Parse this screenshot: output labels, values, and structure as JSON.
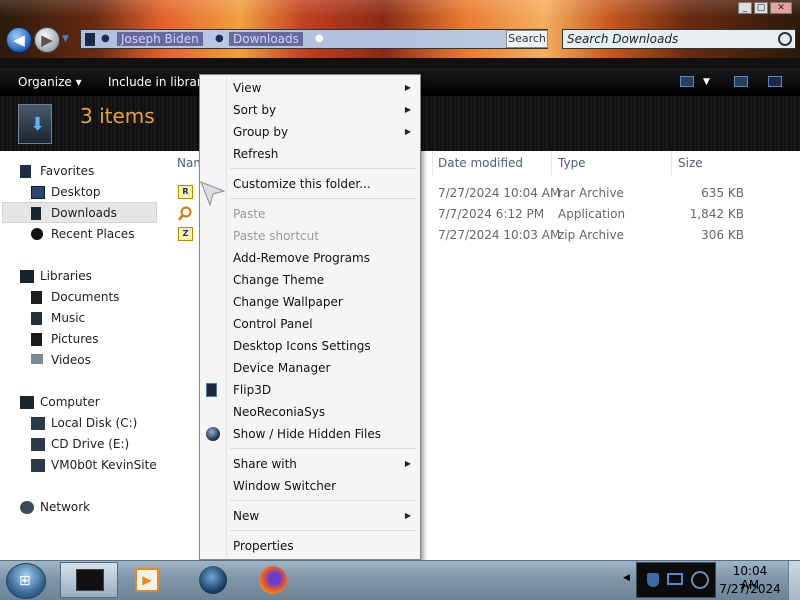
{
  "window": {
    "minimize_label": "_",
    "maximize_label": "▢",
    "close_label": "✕"
  },
  "address": {
    "crumbs": [
      "Joseph Biden",
      "Downloads"
    ],
    "search_button_label": "Search",
    "search_placeholder": "Search Downloads"
  },
  "toolbar": {
    "organize_label": "Organize ▾",
    "include_label": "Include in library"
  },
  "header": {
    "item_count": "3 items"
  },
  "nav": {
    "favorites": {
      "label": "Favorites",
      "items": [
        "Desktop",
        "Downloads",
        "Recent Places"
      ]
    },
    "libraries": {
      "label": "Libraries",
      "items": [
        "Documents",
        "Music",
        "Pictures",
        "Videos"
      ]
    },
    "computer": {
      "label": "Computer",
      "items": [
        "Local Disk (C:)",
        "CD Drive (E:)",
        "VM0b0t KevinSite"
      ]
    },
    "network": {
      "label": "Network"
    }
  },
  "columns": {
    "name": "Nam",
    "date_modified": "Date modified",
    "type": "Type",
    "size": "Size"
  },
  "files": [
    {
      "date": "7/27/2024 10:04 AM",
      "type": "rar Archive",
      "size": "635 KB",
      "icon": "rar-icon",
      "icon_glyph": "R"
    },
    {
      "date": "7/7/2024 6:12 PM",
      "type": "Application",
      "size": "1,842 KB",
      "icon": "application-icon",
      "icon_glyph": ""
    },
    {
      "date": "7/27/2024 10:03 AM",
      "type": "zip Archive",
      "size": "306 KB",
      "icon": "zip-icon",
      "icon_glyph": "Z"
    }
  ],
  "context_menu": {
    "view": "View",
    "sort_by": "Sort by",
    "group_by": "Group by",
    "refresh": "Refresh",
    "customize": "Customize this folder...",
    "paste": "Paste",
    "paste_shortcut": "Paste shortcut",
    "add_remove": "Add-Remove Programs",
    "change_theme": "Change Theme",
    "change_wallpaper": "Change Wallpaper",
    "control_panel": "Control Panel",
    "desktop_icons": "Desktop Icons Settings",
    "device_manager": "Device Manager",
    "flip3d": "Flip3D",
    "neoreconia": "NeoReconiaSys",
    "show_hide": "Show / Hide Hidden Files",
    "share_with": "Share with",
    "window_switcher": "Window Switcher",
    "new": "New",
    "properties": "Properties"
  },
  "taskbar": {
    "time": "10:04 AM",
    "date": "7/27/2024"
  }
}
